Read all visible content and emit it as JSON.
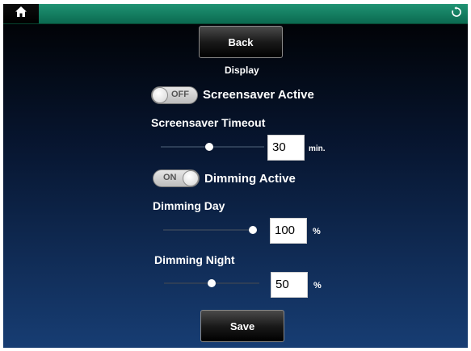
{
  "topbar": {
    "home_icon": "home-icon",
    "refresh_icon": "refresh-icon",
    "color": "#0e7a5c"
  },
  "back_label": "Back",
  "section_title": "Display",
  "screensaver": {
    "toggle_text": "OFF",
    "active_label": "Screensaver Active",
    "timeout_label": "Screensaver Timeout",
    "timeout_value": "30",
    "timeout_unit": "min."
  },
  "dimming": {
    "toggle_text": "ON",
    "active_label": "Dimming Active",
    "day_label": "Dimming Day",
    "day_value": "100",
    "day_unit": "%",
    "night_label": "Dimming Night",
    "night_value": "50",
    "night_unit": "%"
  },
  "save_label": "Save"
}
